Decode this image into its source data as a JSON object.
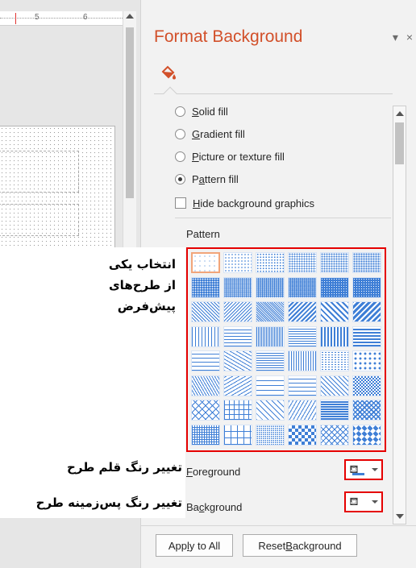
{
  "ruler": {
    "mark_5": "5",
    "mark_6": "6"
  },
  "pane": {
    "title": "Format Background",
    "menu_glyph": "▾",
    "close_glyph": "×",
    "fill_tab_icon": "paint-bucket-icon",
    "accent_color": "#d2502a"
  },
  "fill_options": [
    {
      "label": "Solid fill",
      "access_key": "S",
      "rest": "olid fill",
      "checked": false
    },
    {
      "label": "Gradient fill",
      "access_key": "G",
      "rest": "radient fill",
      "checked": false
    },
    {
      "label": "Picture or texture fill",
      "access_key": "P",
      "rest": "icture or texture fill",
      "checked": false
    },
    {
      "label": "Pattern fill",
      "access_key": "a",
      "checked": true
    }
  ],
  "hide_graphics": {
    "label": "Hide background graphics",
    "access_key": "H",
    "rest": "ide background graphics",
    "checked": false
  },
  "pattern": {
    "label": "Pattern",
    "rows": 8,
    "cols": 6,
    "selected_index": 0,
    "pattern_color": "#3f7fd6",
    "highlight_color": "#e50000"
  },
  "foreground": {
    "label": "Foreground",
    "access_key": "F",
    "rest": "oreground",
    "icon": "paint-bucket-icon",
    "color": "#3f7fd6"
  },
  "background": {
    "label": "Background",
    "prefix": "Ba",
    "access_key": "c",
    "rest": "kground",
    "icon": "paint-bucket-icon",
    "color": "#ffffff"
  },
  "buttons": {
    "apply_all": {
      "prefix": "App",
      "access_key": "l",
      "rest": "y to All"
    },
    "reset": {
      "prefix": "Reset ",
      "access_key": "B",
      "rest": "ackground"
    }
  },
  "annotations": {
    "choose_line1": "انتخاب یکی",
    "choose_line2": "از طرح‌های",
    "choose_line3": "پیش‌فرض",
    "fg_note": "تغییر رنگ قلم طرح",
    "bg_note": "تغییر رنگ پس‌زمینه طرح"
  }
}
